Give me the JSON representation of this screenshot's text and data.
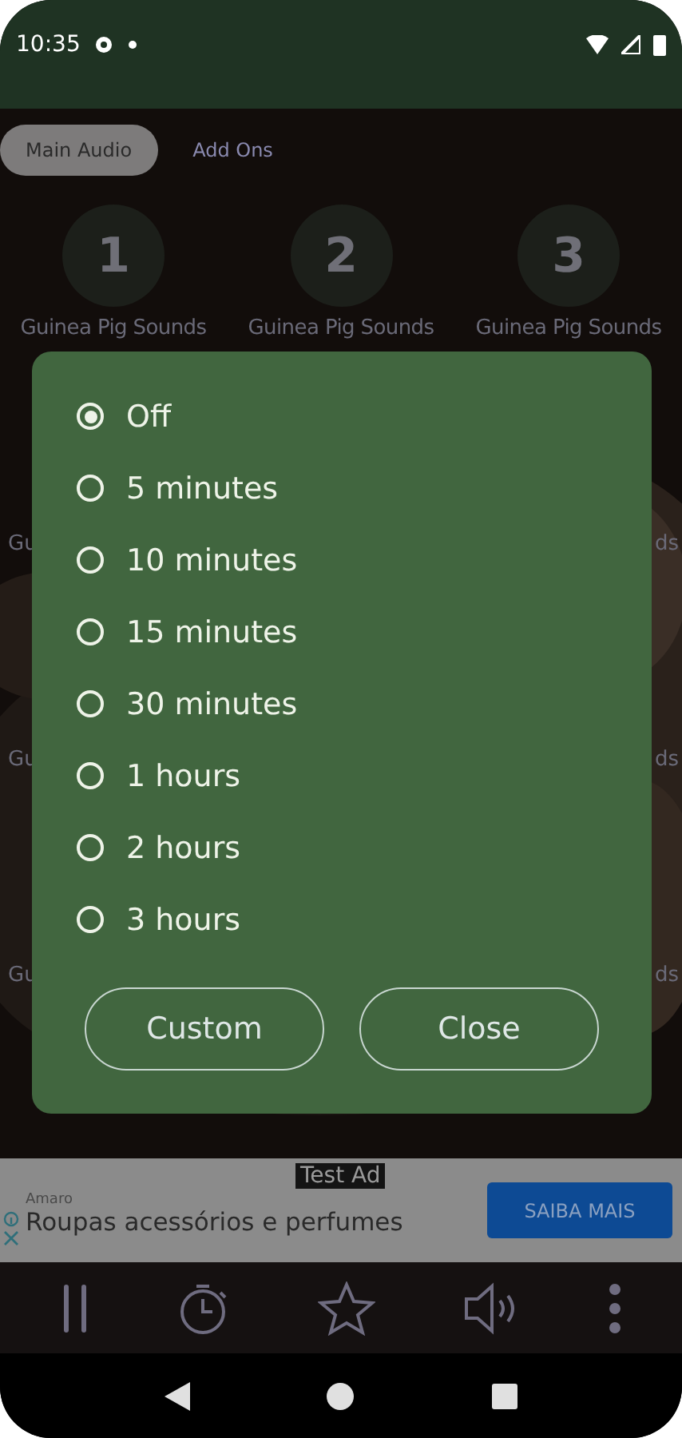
{
  "status_bar": {
    "time": "10:35"
  },
  "tabs": [
    {
      "label": "Main Audio",
      "selected": true
    },
    {
      "label": "Add Ons",
      "selected": false
    }
  ],
  "sound_grid": {
    "tiles": [
      {
        "number": "1",
        "label": "Guinea Pig Sounds"
      },
      {
        "number": "2",
        "label": "Guinea Pig Sounds"
      },
      {
        "number": "3",
        "label": "Guinea Pig Sounds"
      }
    ],
    "partial_rows": [
      {
        "left": "Gu",
        "right": "ds"
      },
      {
        "left": "Gu",
        "right": "ds"
      },
      {
        "left": "Gu",
        "right": "ds"
      }
    ]
  },
  "timer_dialog": {
    "options": [
      {
        "label": "Off",
        "selected": true
      },
      {
        "label": "5 minutes",
        "selected": false
      },
      {
        "label": "10 minutes",
        "selected": false
      },
      {
        "label": "15 minutes",
        "selected": false
      },
      {
        "label": "30 minutes",
        "selected": false
      },
      {
        "label": "1 hours",
        "selected": false
      },
      {
        "label": "2 hours",
        "selected": false
      },
      {
        "label": "3 hours",
        "selected": false
      }
    ],
    "buttons": [
      "Custom",
      "Close"
    ]
  },
  "ad": {
    "badge": "Test Ad",
    "advertiser": "Amaro",
    "headline": "Roupas acessórios e perfumes",
    "cta": "SAIBA MAIS"
  }
}
